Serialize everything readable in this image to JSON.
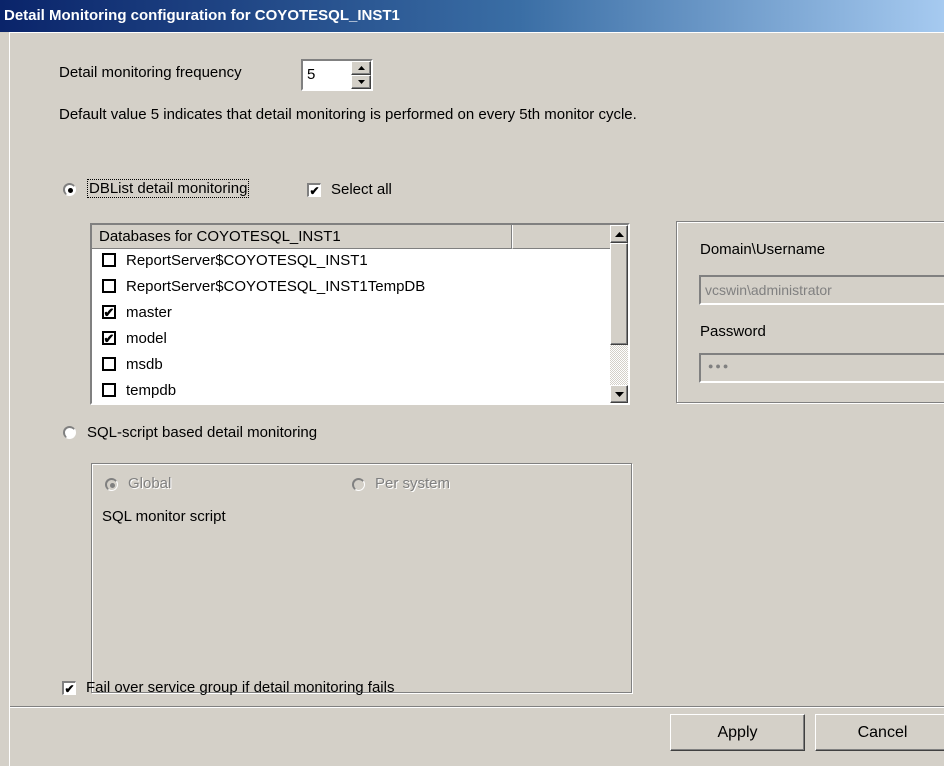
{
  "window": {
    "title": "Detail Monitoring configuration for COYOTESQL_INST1"
  },
  "frequency": {
    "label": "Detail monitoring frequency",
    "value": "5",
    "hint": "Default value 5 indicates that detail monitoring is performed on every 5th monitor cycle."
  },
  "dblist": {
    "radio_label": "DBList detail monitoring",
    "selected": true,
    "select_all_label": "Select all",
    "select_all_checked": true,
    "column_header": "Databases for COYOTESQL_INST1",
    "databases": [
      {
        "name": "ReportServer$COYOTESQL_INST1",
        "checked": false
      },
      {
        "name": "ReportServer$COYOTESQL_INST1TempDB",
        "checked": false
      },
      {
        "name": "master",
        "checked": true
      },
      {
        "name": "model",
        "checked": true
      },
      {
        "name": "msdb",
        "checked": false
      },
      {
        "name": "tempdb",
        "checked": false
      }
    ]
  },
  "credentials": {
    "username_label": "Domain\\Username",
    "username_value": "vcswin\\administrator",
    "password_label": "Password",
    "password_value": "●●●"
  },
  "sqlscript": {
    "radio_label": "SQL-script based detail monitoring",
    "selected": false,
    "global_label": "Global",
    "per_system_label": "Per system",
    "script_label": "SQL monitor script"
  },
  "failover": {
    "label": "Fail over service group if detail monitoring fails",
    "checked": true
  },
  "buttons": {
    "apply": "Apply",
    "cancel": "Cancel"
  },
  "icons": {
    "spin_up": "triangle-up-icon",
    "spin_down": "triangle-down-icon",
    "check": "checkmark-icon",
    "scroll_up": "scroll-up-arrow-icon",
    "scroll_down": "scroll-down-arrow-icon"
  }
}
